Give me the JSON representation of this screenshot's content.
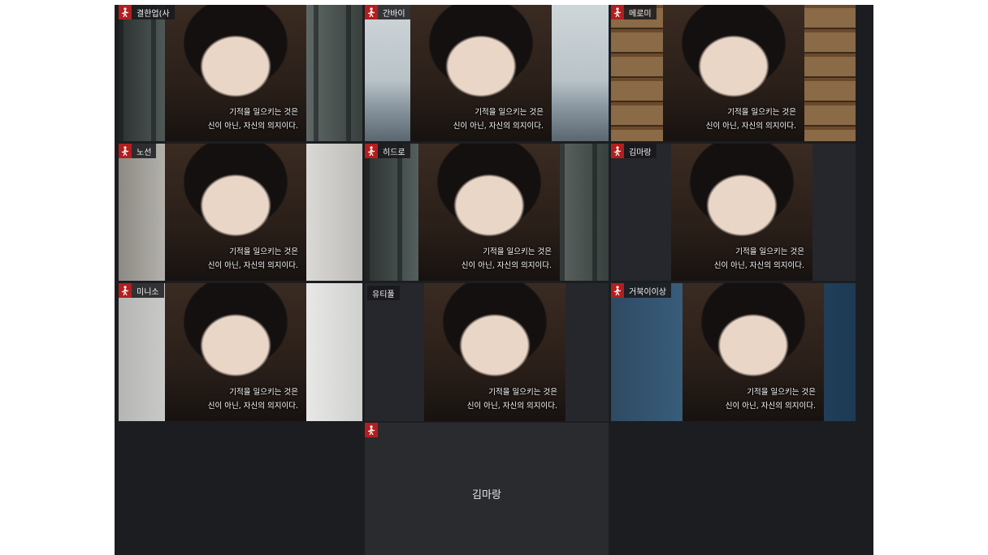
{
  "subtitle": {
    "line1": "기적을 일으키는 것은",
    "line2": "신이 아닌, 자신의 의지이다."
  },
  "colors": {
    "accent": "#1fb3a0",
    "badge": "#b31e1e",
    "background": "#1c1d21"
  },
  "icons": {
    "participant": "fighter-silhouette-icon"
  },
  "participants": [
    {
      "name": "결한업(사"
    },
    {
      "name": "간바이"
    },
    {
      "name": "메로미"
    },
    {
      "name": "노선"
    },
    {
      "name": "히드로"
    },
    {
      "name": "김마랑"
    },
    {
      "name": "미니소"
    },
    {
      "name": "유티풀"
    },
    {
      "name": "거북이이상"
    },
    {
      "name": ""
    }
  ],
  "audio_only_tile": {
    "display_name": "김마랑"
  }
}
